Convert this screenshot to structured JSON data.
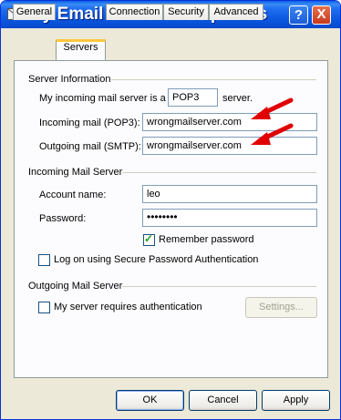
{
  "window": {
    "title": "My Email Account Properties",
    "help_label": "?",
    "close_label": "X"
  },
  "tabs": [
    {
      "label": "General",
      "active": false
    },
    {
      "label": "Servers",
      "active": true
    },
    {
      "label": "Connection",
      "active": false
    },
    {
      "label": "Security",
      "active": false
    },
    {
      "label": "Advanced",
      "active": false
    }
  ],
  "server_info": {
    "heading": "Server Information",
    "incoming_type_prefix": "My incoming mail server is a",
    "incoming_type_value": "POP3",
    "incoming_type_suffix": "server.",
    "incoming_label": "Incoming mail (POP3):",
    "incoming_value": "wrongmailserver.com",
    "outgoing_label": "Outgoing mail (SMTP):",
    "outgoing_value": "wrongmailserver.com"
  },
  "incoming_server": {
    "heading": "Incoming Mail Server",
    "account_label": "Account name:",
    "account_value": "leo",
    "password_label": "Password:",
    "password_value": "••••••••",
    "remember_label": "Remember password",
    "remember_checked": true,
    "spa_label": "Log on using Secure Password Authentication",
    "spa_checked": false
  },
  "outgoing_server": {
    "heading": "Outgoing Mail Server",
    "auth_label": "My server requires authentication",
    "auth_checked": false,
    "settings_label": "Settings..."
  },
  "footer": {
    "ok_label": "OK",
    "cancel_label": "Cancel",
    "apply_label": "Apply"
  },
  "colors": {
    "arrow": "#e00000",
    "titlebar": "#0a57e0",
    "tab_highlight": "#ffc83c"
  }
}
